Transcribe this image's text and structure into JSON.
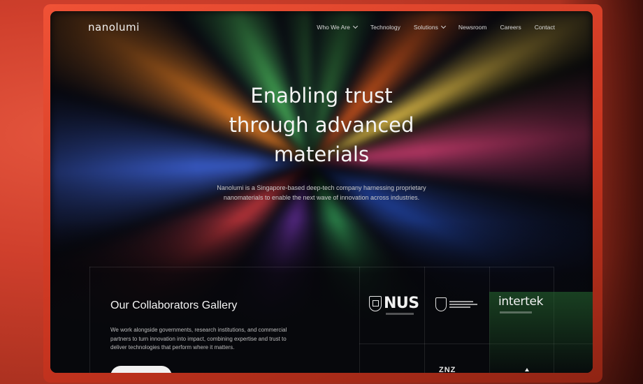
{
  "nav": {
    "logo": "nanolumi",
    "items": [
      {
        "label": "Who We Are",
        "dropdown": true
      },
      {
        "label": "Technology",
        "dropdown": false
      },
      {
        "label": "Solutions",
        "dropdown": true
      },
      {
        "label": "Newsroom",
        "dropdown": false
      },
      {
        "label": "Careers",
        "dropdown": false
      },
      {
        "label": "Contact",
        "dropdown": false
      }
    ]
  },
  "hero": {
    "title_lines": [
      "Enabling trust",
      "through advanced",
      "materials"
    ],
    "subtitle_lines": [
      "Nanolumi is a Singapore-based deep-tech company harnessing proprietary",
      "nanomaterials to enable the next wave of innovation across industries."
    ]
  },
  "collaborators": {
    "title": "Our Collaborators Gallery",
    "description_lines": [
      "We work alongside governments, research institutions, and commercial",
      "partners to turn innovation into impact, combining expertise and trust to",
      "deliver technologies that perform where it matters."
    ],
    "logos": {
      "nus": "NUS",
      "intertek": "intertek",
      "partial": "ZNZ"
    }
  },
  "colors": {
    "backdrop": "#c8402e",
    "screen": "#07080d",
    "text": "#f4f4f4",
    "button": "#f1f1f1"
  }
}
